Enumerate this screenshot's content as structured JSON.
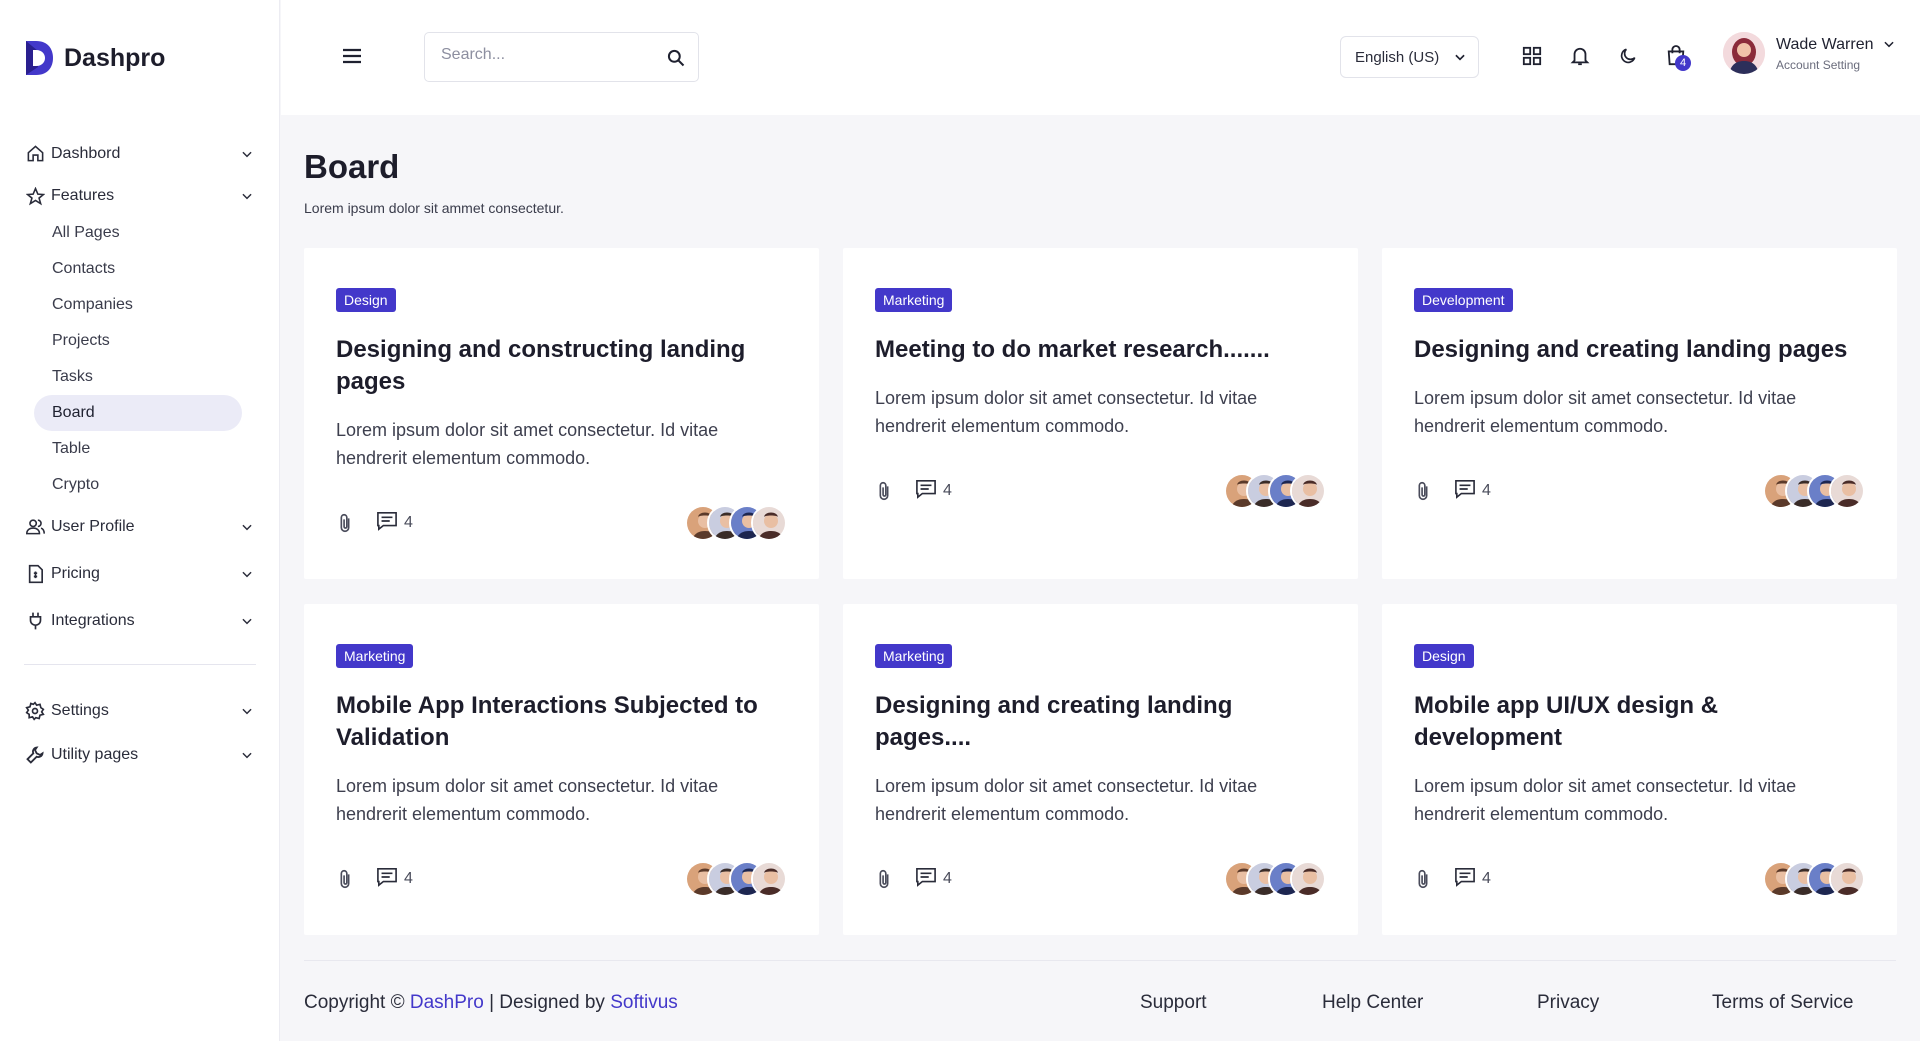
{
  "app": {
    "name": "Dashpro",
    "accent": "#4338ca"
  },
  "sidebar": {
    "items": [
      {
        "label": "Dashbord",
        "icon": "home-icon"
      },
      {
        "label": "Features",
        "icon": "star-icon"
      },
      {
        "label": "User Profile",
        "icon": "users-icon"
      },
      {
        "label": "Pricing",
        "icon": "document-icon"
      },
      {
        "label": "Integrations",
        "icon": "plug-icon"
      }
    ],
    "features_sub": [
      "All Pages",
      "Contacts",
      "Companies",
      "Projects",
      "Tasks",
      "Board",
      "Table",
      "Crypto"
    ],
    "active_sub": "Board",
    "bottom_items": [
      {
        "label": "Settings",
        "icon": "gear-icon"
      },
      {
        "label": "Utility pages",
        "icon": "wrench-icon"
      }
    ]
  },
  "topbar": {
    "search_placeholder": "Search...",
    "language": "English (US)",
    "cart_count": "4",
    "user_name": "Wade Warren",
    "user_role": "Account Setting"
  },
  "page": {
    "title": "Board",
    "subtitle": "Lorem ipsum dolor sit ammet consectetur."
  },
  "cards": [
    {
      "tag": "Design",
      "title": "Designing and constructing landing pages",
      "desc": "Lorem ipsum dolor sit amet consectetur. Id vitae hendrerit elementum commodo.",
      "comments": "4"
    },
    {
      "tag": "Marketing",
      "title": "Meeting to do market research.......",
      "desc": "Lorem ipsum dolor sit amet consectetur. Id vitae hendrerit elementum commodo.",
      "comments": "4"
    },
    {
      "tag": "Development",
      "title": "Designing and creating landing pages",
      "desc": "Lorem ipsum dolor sit amet consectetur. Id vitae hendrerit elementum commodo.",
      "comments": "4"
    },
    {
      "tag": "Marketing",
      "title": "Mobile App Interactions Subjected to Validation",
      "desc": "Lorem ipsum dolor sit amet consectetur. Id vitae hendrerit elementum commodo.",
      "comments": "4"
    },
    {
      "tag": "Marketing",
      "title": "Designing and creating landing pages....",
      "desc": "Lorem ipsum dolor sit amet consectetur. Id vitae hendrerit elementum commodo.",
      "comments": "4"
    },
    {
      "tag": "Design",
      "title": "Mobile app UI/UX design & development",
      "desc": "Lorem ipsum dolor sit amet consectetur. Id vitae hendrerit elementum commodo.",
      "comments": "4"
    }
  ],
  "footer": {
    "copyright_prefix": "Copyright ©",
    "brand": "DashPro",
    "separator": "| Designed by",
    "designer": "Softivus",
    "links": [
      "Support",
      "Help Center",
      "Privacy",
      "Terms of Service"
    ]
  }
}
